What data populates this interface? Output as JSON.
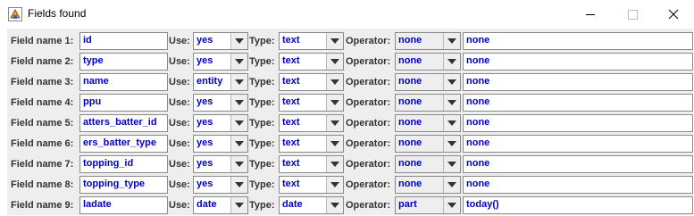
{
  "window": {
    "title": "Fields found"
  },
  "labels": {
    "use": "Use:",
    "type": "Type:",
    "operator": "Operator:"
  },
  "rows": [
    {
      "label": "Field name 1:",
      "field": "id",
      "use": "yes",
      "type": "text",
      "operator": "none",
      "value": "none"
    },
    {
      "label": "Field name 2:",
      "field": "type",
      "use": "yes",
      "type": "text",
      "operator": "none",
      "value": "none"
    },
    {
      "label": "Field name 3:",
      "field": "name",
      "use": "entity",
      "type": "text",
      "operator": "none",
      "value": "none"
    },
    {
      "label": "Field name 4:",
      "field": "ppu",
      "use": "yes",
      "type": "text",
      "operator": "none",
      "value": "none"
    },
    {
      "label": "Field name 5:",
      "field": "atters_batter_id",
      "use": "yes",
      "type": "text",
      "operator": "none",
      "value": "none"
    },
    {
      "label": "Field name 6:",
      "field": "ers_batter_type",
      "use": "yes",
      "type": "text",
      "operator": "none",
      "value": "none"
    },
    {
      "label": "Field name 7:",
      "field": "topping_id",
      "use": "yes",
      "type": "text",
      "operator": "none",
      "value": "none"
    },
    {
      "label": "Field name 8:",
      "field": "topping_type",
      "use": "yes",
      "type": "text",
      "operator": "none",
      "value": "none"
    },
    {
      "label": "Field name 9:",
      "field": "ladate",
      "use": "date",
      "type": "date",
      "operator": "part",
      "value": "today()"
    }
  ]
}
